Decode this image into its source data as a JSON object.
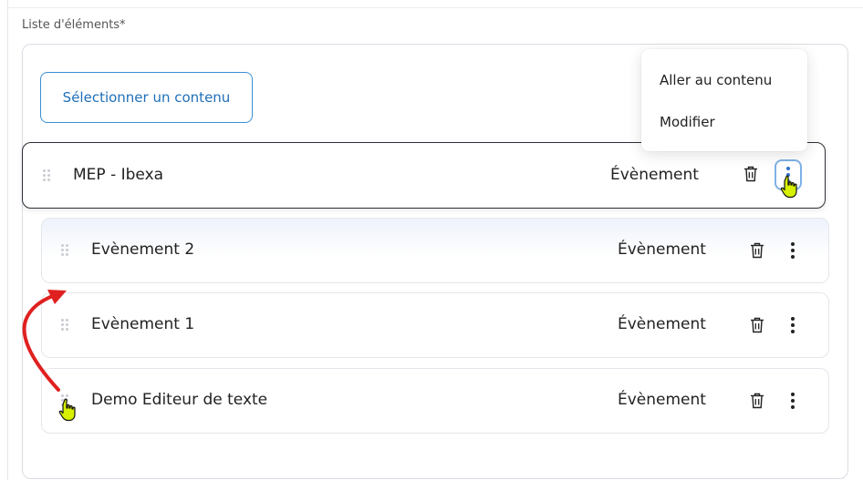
{
  "field": {
    "label": "Liste d'éléments*",
    "select_button_label": "Sélectionner un contenu"
  },
  "items": [
    {
      "title": "MEP - Ibexa",
      "type": "Évènement",
      "active": true
    },
    {
      "title": "Evènement 2",
      "type": "Évènement",
      "active": false
    },
    {
      "title": "Evènement 1",
      "type": "Évènement",
      "active": false
    },
    {
      "title": "Demo Editeur de texte",
      "type": "Évènement",
      "active": false
    }
  ],
  "context_menu": {
    "items": [
      "Aller au contenu",
      "Modifier"
    ]
  },
  "colors": {
    "accent_blue": "#1f6fb8",
    "focus_ring": "#7fb1e6",
    "annotation_arrow": "#e02020",
    "cursor_yellow": "#d6f000"
  },
  "icons": {
    "drag": "drag-handle-icon",
    "delete": "trash-icon",
    "more": "kebab-menu-icon",
    "pointer": "hand-pointer-cursor-icon"
  }
}
